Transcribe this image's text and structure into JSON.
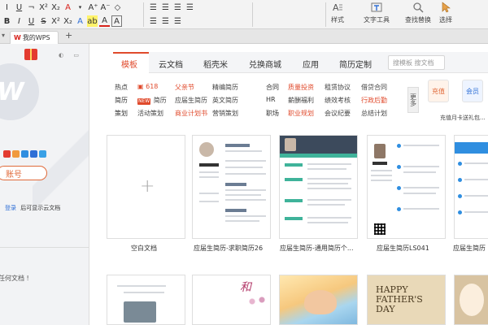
{
  "ribbon": {
    "row1_icons": [
      "I",
      "U",
      "¬",
      "X²",
      "X₂",
      "A",
      "▾"
    ],
    "row1_right": [
      "A⁺",
      "A⁻",
      "◇"
    ],
    "row2_icons": [
      "B",
      "I",
      "U",
      "S",
      "X²",
      "X₂",
      "A",
      "ab",
      "A",
      "A"
    ],
    "paragraph_icons": [
      "☰",
      "☰",
      "☰",
      "☰",
      "☰",
      "☰",
      "☰"
    ],
    "style_label": "样式",
    "text_tool_label": "文字工具",
    "find_replace_label": "查找替换",
    "select_label": "选择"
  },
  "tabbar": {
    "doc_tab": "我的WPS",
    "add": "+"
  },
  "left_panel": {
    "login_button": "账号",
    "login_tip_link": "登录",
    "login_tip_text": "后可显示云文档",
    "empty_text": "任何文档 !",
    "mini_icon_colors": [
      "#e33b30",
      "#f19a3e",
      "#2f8ee0",
      "#2f6fd6",
      "#39a0e6"
    ]
  },
  "main": {
    "nav_tabs": [
      "模板",
      "云文档",
      "稻壳米",
      "兑换商城",
      "应用",
      "简历定制"
    ],
    "search_placeholder": "搜模板   搜文档",
    "categories": {
      "row1": {
        "label": "热点",
        "items": [
          "618",
          "父亲节",
          "精编简历"
        ]
      },
      "row2": {
        "label": "简历",
        "new_badge": "NEW",
        "items": [
          "简历",
          "应届生简历",
          "英文简历"
        ]
      },
      "row3": {
        "label": "策划",
        "items": [
          "活动策划",
          "商业计划书",
          "营销策划"
        ]
      },
      "col2": [
        {
          "label": "合同",
          "items": [
            "质量投资",
            "租赁协议",
            "借贷合同"
          ]
        },
        {
          "label": "HR",
          "items": [
            "薪酬福利",
            "绩效考核",
            "行政后勤"
          ]
        },
        {
          "label": "职场",
          "items": [
            "职业规划",
            "会议纪要",
            "总结计划"
          ]
        }
      ],
      "more": "更多"
    },
    "promo": {
      "item1": "充值",
      "item2": "会员",
      "caption": "充值月卡送礼包..."
    },
    "cards": [
      {
        "caption": "空白文档"
      },
      {
        "caption": "应届生简历-求职简历26"
      },
      {
        "caption": "应届生简历-通用简历个..."
      },
      {
        "caption": "应届生简历LS041"
      },
      {
        "caption": "应届生简历"
      }
    ],
    "thumb_text": {
      "fathers_line1": "HAPPY",
      "fathers_line2": "FATHER'S",
      "fathers_line3": "DAY",
      "script": "和"
    },
    "accent": "#e04a2c",
    "link_blue": "#2f6fd6"
  }
}
